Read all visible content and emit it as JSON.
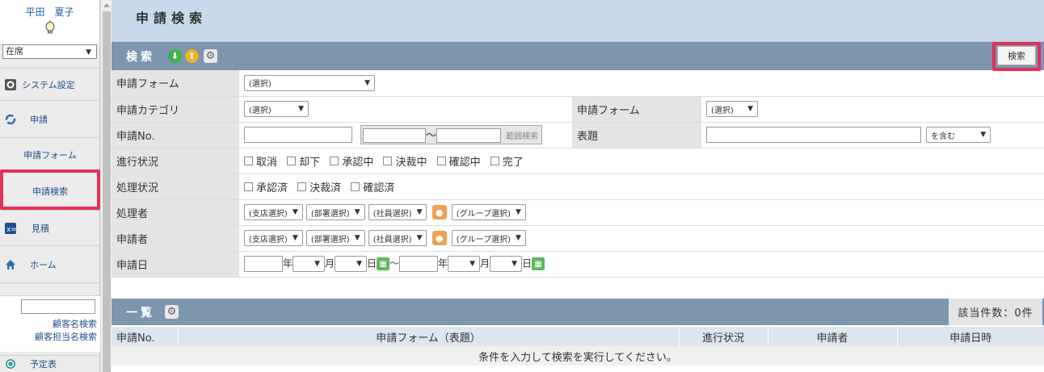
{
  "sidebar": {
    "user_name": "平田　夏子",
    "status": "在席",
    "items": [
      {
        "label": "システム設定"
      },
      {
        "label": "申請"
      },
      {
        "label": "申請フォーム"
      },
      {
        "label": "申請検索"
      },
      {
        "label": "見積"
      },
      {
        "label": "ホーム"
      }
    ],
    "customer_search_link": "顧客名検索",
    "customer_rep_search_link": "顧客担当名検索",
    "schedule_label": "予定表"
  },
  "header": {
    "title": "申請検索"
  },
  "search": {
    "title": "検索",
    "search_button": "検索",
    "rows": {
      "form_label": "申請フォーム",
      "form_value": "(選択)",
      "category_label": "申請カテゴリ",
      "category_value": "(選択)",
      "form2_label": "申請フォーム",
      "form2_value": "(選択)",
      "no_label": "申請No.",
      "range_sep": "～",
      "range_button": "範囲検索",
      "subject_label": "表題",
      "subject_mode": "を含む",
      "progress_label": "進行状況",
      "progress_options": [
        "取消",
        "却下",
        "承認中",
        "決裁中",
        "確認中",
        "完了"
      ],
      "process_label": "処理状況",
      "process_options": [
        "承認済",
        "決裁済",
        "確認済"
      ],
      "handler_label": "処理者",
      "applicant_label": "申請者",
      "branch_select": "(支店選択)",
      "dept_select": "(部署選択)",
      "staff_select": "(社員選択)",
      "group_select": "(グループ選択)",
      "date_label": "申請日",
      "year": "年",
      "month": "月",
      "day": "日",
      "date_sep": "～"
    }
  },
  "list": {
    "title": "一覧",
    "count": "該当件数：0件",
    "columns": [
      "申請No.",
      "申請フォーム（表題）",
      "進行状況",
      "申請者",
      "申請日時"
    ],
    "empty_message": "条件を入力して検索を実行してください。"
  },
  "colors": {
    "highlight": "#e0325a",
    "bar": "#7d95ad",
    "title_bg": "#c9d9ea"
  }
}
